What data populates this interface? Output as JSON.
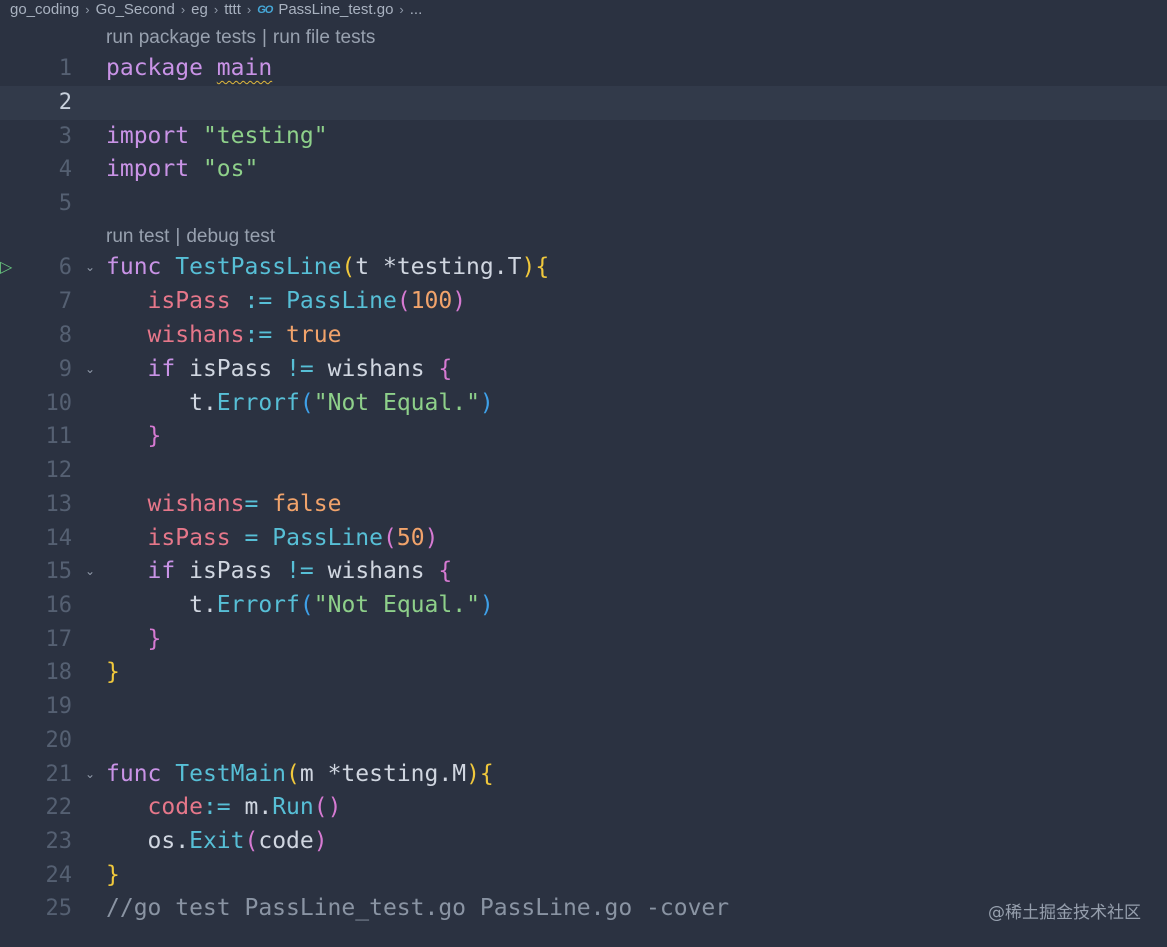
{
  "breadcrumb": {
    "items": [
      "go_coding",
      "Go_Second",
      "eg",
      "tttt",
      "PassLine_test.go",
      "..."
    ],
    "file_icon": "go-file-icon",
    "separator": "›"
  },
  "codelens": {
    "package_tests": "run package tests",
    "file_tests": "run file tests",
    "run_test": "run test",
    "debug_test": "debug test",
    "separator": "|"
  },
  "editor": {
    "line_numbers": [
      "1",
      "2",
      "3",
      "4",
      "5",
      "6",
      "7",
      "8",
      "9",
      "10",
      "11",
      "12",
      "13",
      "14",
      "15",
      "16",
      "17",
      "18",
      "19",
      "20",
      "21",
      "22",
      "23",
      "24",
      "25"
    ],
    "current_line": 2,
    "tokens": {
      "l1": [
        "package",
        "main"
      ],
      "l3": [
        "import",
        "\"testing\""
      ],
      "l4": [
        "import",
        "\"os\""
      ],
      "l6": [
        "func",
        "TestPassLine",
        "(",
        "t *testing.T",
        ")",
        "{"
      ],
      "l7": [
        "isPass",
        ":=",
        "PassLine",
        "(",
        "100",
        ")"
      ],
      "l8": [
        "wishans",
        ":=",
        "true"
      ],
      "l9": [
        "if",
        "isPass",
        "!=",
        "wishans",
        "{"
      ],
      "l10": [
        "t.",
        "Errorf",
        "(",
        "\"Not Equal.\"",
        ")"
      ],
      "l11": [
        "}"
      ],
      "l13": [
        "wishans",
        "=",
        "false"
      ],
      "l14": [
        "isPass",
        "=",
        "PassLine",
        "(",
        "50",
        ")"
      ],
      "l15": [
        "if",
        "isPass",
        "!=",
        "wishans",
        "{"
      ],
      "l16": [
        "t.",
        "Errorf",
        "(",
        "\"Not Equal.\"",
        ")"
      ],
      "l17": [
        "}"
      ],
      "l18": [
        "}"
      ],
      "l21": [
        "func",
        "TestMain",
        "(",
        "m *testing.M",
        ")",
        "{"
      ],
      "l22": [
        "code",
        ":=",
        "m.",
        "Run",
        "(",
        ")"
      ],
      "l23": [
        "os.",
        "Exit",
        "(",
        "code",
        ")"
      ],
      "l24": [
        "}"
      ],
      "l25": [
        "//go test PassLine_test.go PassLine.go -cover"
      ]
    }
  },
  "watermark": "@稀土掘金技术社区",
  "colors": {
    "background": "#2b3241",
    "current_line": "#323a4a",
    "keyword": "#c993e6",
    "string": "#8ed08a",
    "function": "#57bfd6",
    "variable": "#e6778a",
    "number": "#f1a36b",
    "comment": "#8a94a3"
  }
}
